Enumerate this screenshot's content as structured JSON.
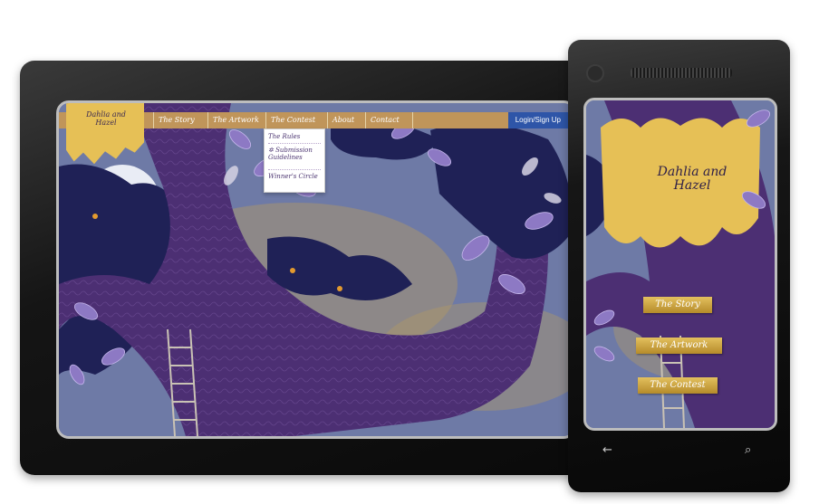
{
  "site": {
    "logo_text": "Dahlia and Hazel"
  },
  "navbar": {
    "items": [
      {
        "label": "The Story"
      },
      {
        "label": "The Artwork"
      },
      {
        "label": "The Contest"
      },
      {
        "label": "About"
      },
      {
        "label": "Contact"
      }
    ],
    "login_label": "Login/Sign Up"
  },
  "dropdown": {
    "items": [
      {
        "label": "The Rules"
      },
      {
        "label": "Submission Guidelines"
      },
      {
        "label": "Winner's Circle"
      }
    ]
  },
  "phone": {
    "logo_text": "Dahlia and Hazel",
    "buttons": [
      {
        "label": "The Story"
      },
      {
        "label": "The Artwork"
      },
      {
        "label": "The Contest"
      }
    ],
    "hw_back_icon": "back-arrow-icon",
    "hw_search_icon": "search-icon"
  },
  "colors": {
    "sky": "#6e7aa6",
    "tree": "#4c2f73",
    "gold": "#e6c056",
    "navbar": "#c0955a",
    "login": "#2e55a8"
  }
}
